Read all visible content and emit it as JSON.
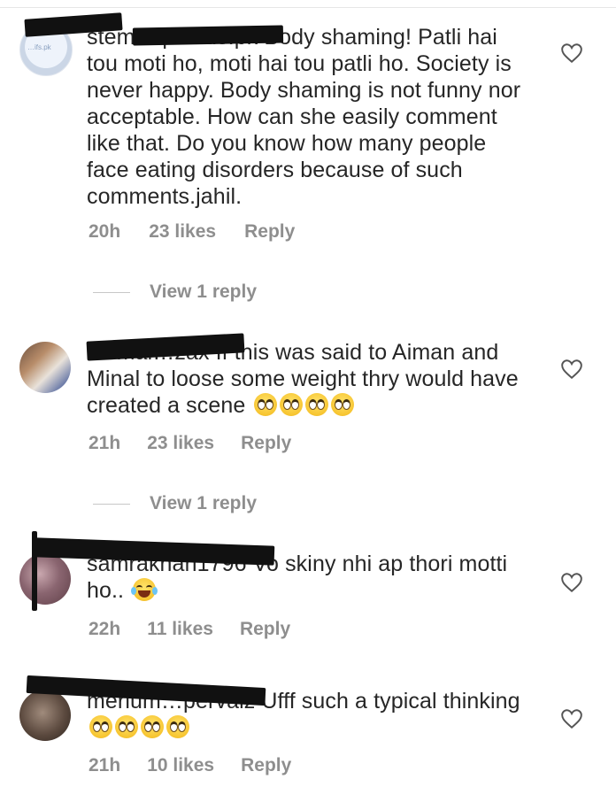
{
  "comments": [
    {
      "username": "stem…ipotatis.pk",
      "text": "Body shaming! Patli hai tou moti ho, moti hai tou patli ho. Society is never happy. Body shaming is not funny nor acceptable. How can she easily comment like that. Do you know how many people face eating disorders because of such comments.jahil.",
      "time": "20h",
      "likes": "23 likes",
      "reply": "Reply",
      "view_replies": "View 1 reply",
      "avatar_text": "…ifs.pk"
    },
    {
      "username": "naimal…zax",
      "text": "If this was said to Aiman and Minal to loose some weight thry would have created a scene",
      "emojis": [
        "face-with-rolling-eyes",
        "face-with-rolling-eyes",
        "face-with-rolling-eyes",
        "face-with-rolling-eyes"
      ],
      "time": "21h",
      "likes": "23 likes",
      "reply": "Reply",
      "view_replies": "View 1 reply"
    },
    {
      "username": "samrakhan1796",
      "text": "Vo skiny nhi ap thori motti ho..",
      "emojis": [
        "face-with-tears-of-joy"
      ],
      "time": "22h",
      "likes": "11 likes",
      "reply": "Reply"
    },
    {
      "username": "merium…pervaiz",
      "text": "Ufff such a typical thinking",
      "emojis": [
        "face-with-rolling-eyes",
        "face-with-rolling-eyes",
        "face-with-rolling-eyes",
        "face-with-rolling-eyes"
      ],
      "time": "21h",
      "likes": "10 likes",
      "reply": "Reply"
    }
  ],
  "icons": {
    "like": "heart-outline-icon"
  },
  "colors": {
    "text": "#262626",
    "meta": "#8e8e8e",
    "redaction": "#111111"
  }
}
